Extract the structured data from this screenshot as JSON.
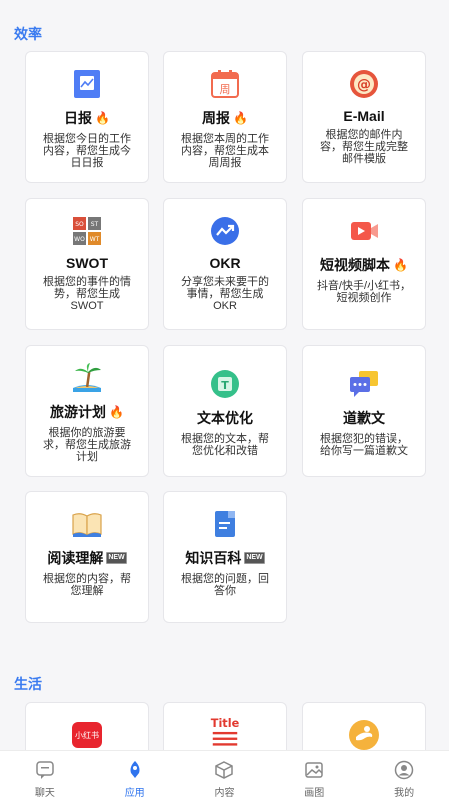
{
  "sections": {
    "efficiency": "效率",
    "life": "生活"
  },
  "efficiency_cards": [
    {
      "name": "日报",
      "hot": true,
      "is_new": false,
      "desc": "根据您今日的工作内容，帮您生成今日日报",
      "icon": "daily-report-icon"
    },
    {
      "name": "周报",
      "hot": true,
      "is_new": false,
      "desc": "根据您本周的工作内容，帮您生成本周周报",
      "icon": "weekly-calendar-icon"
    },
    {
      "name": "E-Mail",
      "hot": false,
      "is_new": false,
      "desc": "根据您的邮件内容，帮您生成完整邮件模版",
      "icon": "email-at-icon"
    },
    {
      "name": "SWOT",
      "hot": false,
      "is_new": false,
      "desc": "根据您的事件的情势，帮您生成SWOT",
      "icon": "swot-grid-icon"
    },
    {
      "name": "OKR",
      "hot": false,
      "is_new": false,
      "desc": "分享您未来要干的事情，帮您生成OKR",
      "icon": "trend-icon"
    },
    {
      "name": "短视频脚本",
      "hot": true,
      "is_new": false,
      "desc": "抖音/快手/小红书，短视频创作",
      "icon": "video-icon"
    },
    {
      "name": "旅游计划",
      "hot": true,
      "is_new": false,
      "desc": "根据你的旅游要求，帮您生成旅游计划",
      "icon": "palm-tree-icon"
    },
    {
      "name": "文本优化",
      "hot": false,
      "is_new": false,
      "desc": "根据您的文本，帮您优化和改错",
      "icon": "text-t-icon"
    },
    {
      "name": "道歉文",
      "hot": false,
      "is_new": false,
      "desc": "根据您犯的错误，给你写一篇道歉文",
      "icon": "chat-bubbles-icon"
    },
    {
      "name": "阅读理解",
      "hot": false,
      "is_new": true,
      "desc": "根据您的内容，帮您理解",
      "icon": "book-icon"
    },
    {
      "name": "知识百科",
      "hot": false,
      "is_new": true,
      "desc": "根据您的问题，回答你",
      "icon": "encyclopedia-icon"
    }
  ],
  "hot_mark": "🔥",
  "new_mark": "NEW",
  "life_cards": [
    {
      "icon": "xiaohongshu-icon",
      "icon_text": "小红书"
    },
    {
      "icon": "title-icon",
      "icon_text": "Title"
    },
    {
      "icon": "hand-icon",
      "icon_text": ""
    }
  ],
  "tabs": [
    {
      "label": "聊天",
      "icon": "chat-icon",
      "active": false
    },
    {
      "label": "应用",
      "icon": "app-icon",
      "active": true
    },
    {
      "label": "内容",
      "icon": "cube-icon",
      "active": false
    },
    {
      "label": "画图",
      "icon": "image-icon",
      "active": false
    },
    {
      "label": "我的",
      "icon": "profile-icon",
      "active": false
    }
  ],
  "colors": {
    "accent": "#2f74ee",
    "section_title": "#3a7bf0",
    "hot": "#f05a22"
  }
}
